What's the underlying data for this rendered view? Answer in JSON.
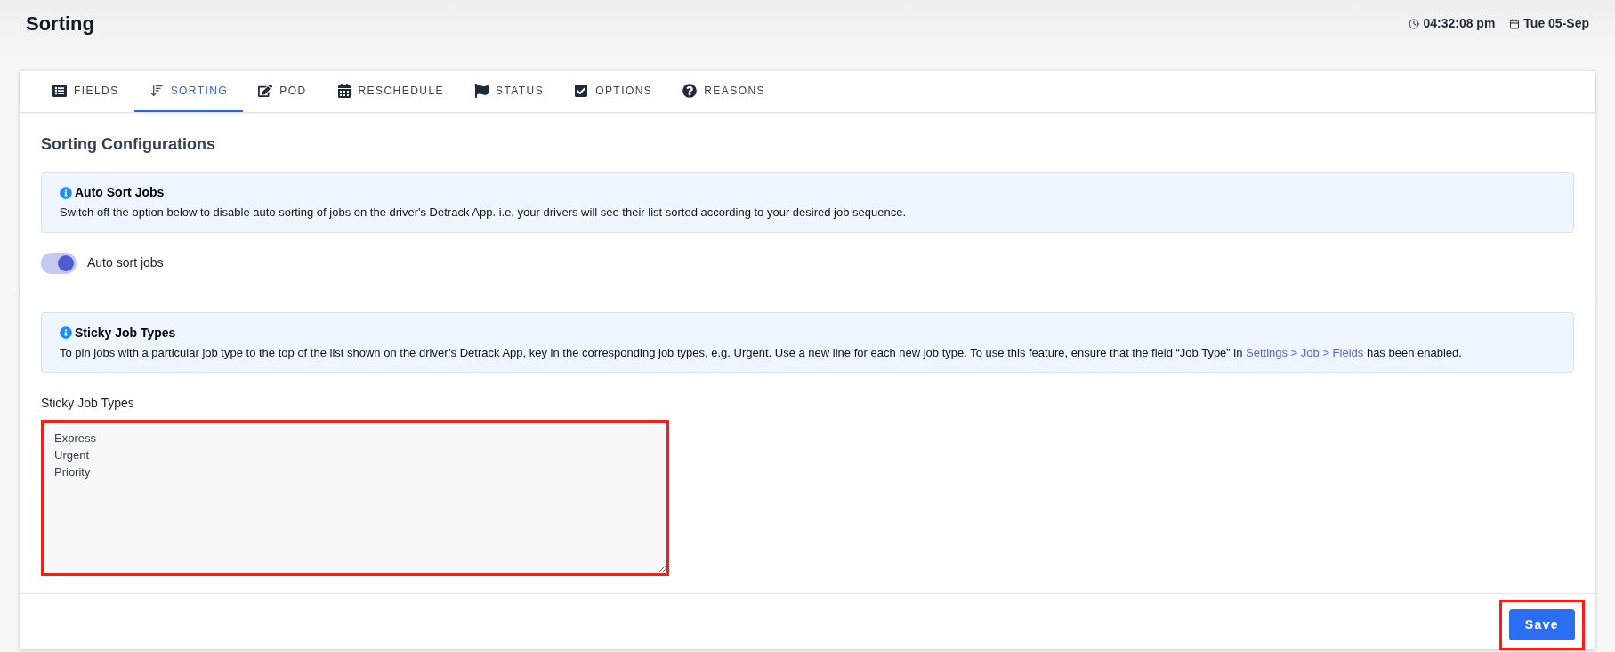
{
  "page": {
    "title": "Sorting",
    "time": "04:32:08 pm",
    "date": "Tue 05-Sep"
  },
  "tabs": [
    {
      "label": "FIELDS",
      "kind": "list",
      "selected": false
    },
    {
      "label": "SORTING",
      "kind": "sort",
      "selected": true
    },
    {
      "label": "POD",
      "kind": "edit",
      "selected": false
    },
    {
      "label": "RESCHEDULE",
      "kind": "calendar",
      "selected": false
    },
    {
      "label": "STATUS",
      "kind": "flag",
      "selected": false
    },
    {
      "label": "OPTIONS",
      "kind": "check",
      "selected": false
    },
    {
      "label": "REASONS",
      "kind": "question",
      "selected": false
    }
  ],
  "heading": "Sorting Configurations",
  "auto_sort": {
    "info_title": "Auto Sort Jobs",
    "info_text": "Switch off the option below to disable auto sorting of jobs on the driver's Detrack App. i.e. your drivers will see their list sorted according to your desired job sequence.",
    "toggle_label": "Auto sort jobs",
    "on": true
  },
  "sticky": {
    "info_title": "Sticky Job Types",
    "info_text_before": "To pin jobs with a particular job type to the top of the list shown on the driver’s Detrack App, key in the corresponding job types, e.g. Urgent. Use a new line for each new job type. To use this feature, ensure that the field “Job Type” in",
    "link": "Settings > Job > Fields",
    "info_text_after": "has been enabled.",
    "field_label": "Sticky Job Types",
    "value": "Express\nUrgent\nPriority",
    "highlighted": true
  },
  "save": {
    "label": "Save",
    "highlighted": true
  }
}
